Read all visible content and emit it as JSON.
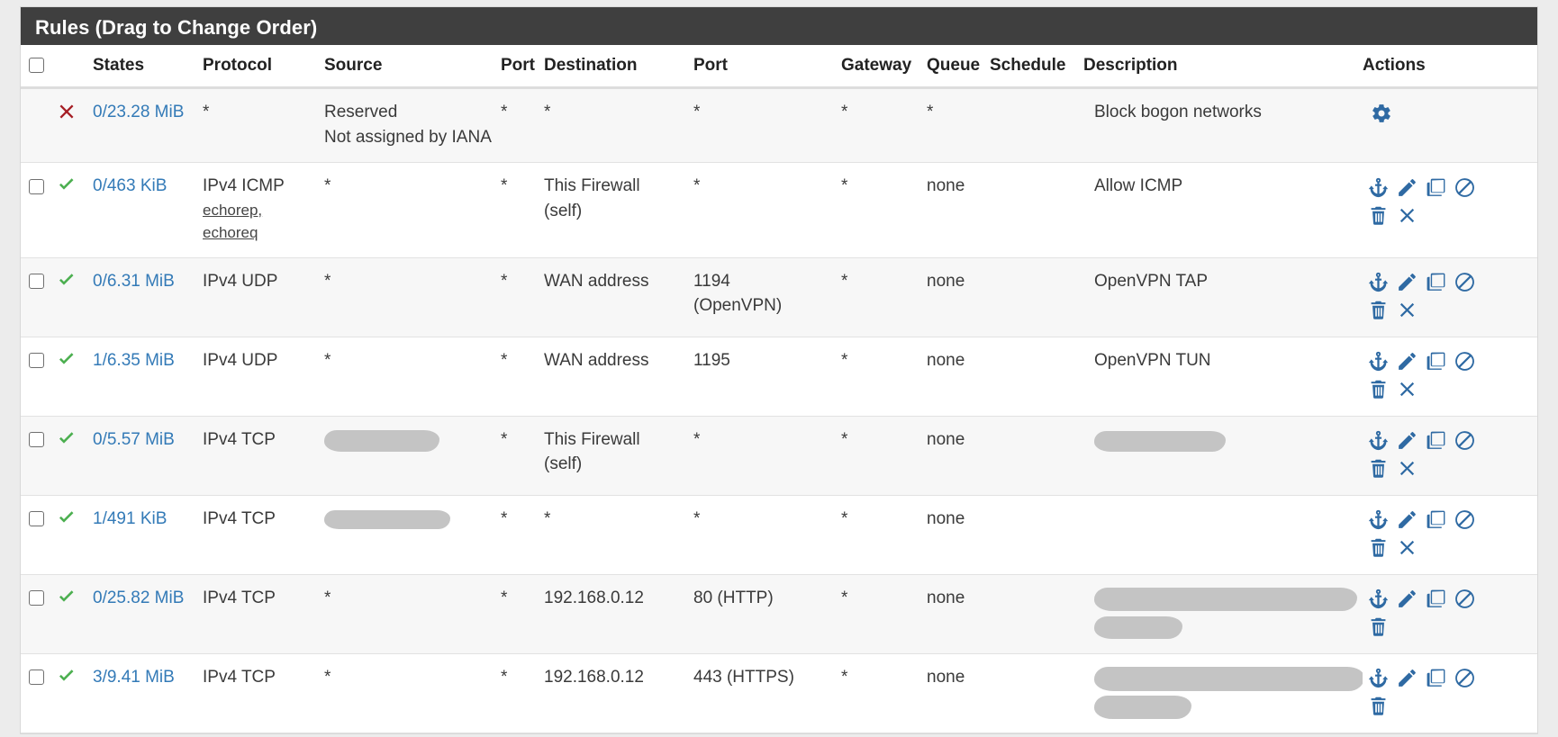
{
  "panel": {
    "title": "Rules (Drag to Change Order)"
  },
  "table": {
    "columns": [
      {
        "key": "check",
        "label": ""
      },
      {
        "key": "action",
        "label": ""
      },
      {
        "key": "states",
        "label": "States"
      },
      {
        "key": "protocol",
        "label": "Protocol"
      },
      {
        "key": "source",
        "label": "Source"
      },
      {
        "key": "sport",
        "label": "Port"
      },
      {
        "key": "dest",
        "label": "Destination"
      },
      {
        "key": "dport",
        "label": "Port"
      },
      {
        "key": "gateway",
        "label": "Gateway"
      },
      {
        "key": "queue",
        "label": "Queue"
      },
      {
        "key": "schedule",
        "label": "Schedule"
      },
      {
        "key": "desc",
        "label": "Description"
      },
      {
        "key": "actions",
        "label": "Actions"
      }
    ],
    "rows": [
      {
        "action_icon": "block-x-icon",
        "has_checkbox": false,
        "states": "0/23.28 MiB",
        "protocol": "*",
        "protocol_sub": [],
        "source": "Reserved\nNot assigned by IANA",
        "source_redacted": false,
        "sport": "*",
        "dest": "*",
        "dport": "*",
        "gateway": "*",
        "queue": "*",
        "schedule": "",
        "desc": "Block bogon networks",
        "desc_redacted": false,
        "actions": [
          "gear-icon"
        ]
      },
      {
        "action_icon": "pass-check-icon",
        "has_checkbox": true,
        "states": "0/463 KiB",
        "protocol": "IPv4 ICMP",
        "protocol_sub": [
          "echorep,",
          "echoreq"
        ],
        "source": "*",
        "source_redacted": false,
        "sport": "*",
        "dest": "This Firewall (self)",
        "dport": "*",
        "gateway": "*",
        "queue": "none",
        "schedule": "",
        "desc": "Allow ICMP",
        "desc_redacted": false,
        "actions": [
          "anchor-icon",
          "edit-pencil-icon",
          "copy-icon",
          "disable-ban-icon",
          "delete-trash-icon",
          "remove-x-icon"
        ]
      },
      {
        "action_icon": "pass-check-icon",
        "has_checkbox": true,
        "states": "0/6.31 MiB",
        "protocol": "IPv4 UDP",
        "protocol_sub": [],
        "source": "*",
        "source_redacted": false,
        "sport": "*",
        "dest": "WAN address",
        "dport": "1194 (OpenVPN)",
        "gateway": "*",
        "queue": "none",
        "schedule": "",
        "desc": "OpenVPN TAP",
        "desc_redacted": false,
        "actions": [
          "anchor-icon",
          "edit-pencil-icon",
          "copy-icon",
          "disable-ban-icon",
          "delete-trash-icon",
          "remove-x-icon"
        ]
      },
      {
        "action_icon": "pass-check-icon",
        "has_checkbox": true,
        "states": "1/6.35 MiB",
        "protocol": "IPv4 UDP",
        "protocol_sub": [],
        "source": "*",
        "source_redacted": false,
        "sport": "*",
        "dest": "WAN address",
        "dport": "1195",
        "gateway": "*",
        "queue": "none",
        "schedule": "",
        "desc": "OpenVPN TUN",
        "desc_redacted": false,
        "actions": [
          "anchor-icon",
          "edit-pencil-icon",
          "copy-icon",
          "disable-ban-icon",
          "delete-trash-icon",
          "remove-x-icon"
        ]
      },
      {
        "action_icon": "pass-check-icon",
        "has_checkbox": true,
        "states": "0/5.57 MiB",
        "protocol": "IPv4 TCP",
        "protocol_sub": [],
        "source": "",
        "source_redacted": true,
        "sport": "*",
        "dest": "This Firewall (self)",
        "dport": "*",
        "gateway": "*",
        "queue": "none",
        "schedule": "",
        "desc": "",
        "desc_redacted": true,
        "actions": [
          "anchor-icon",
          "edit-pencil-icon",
          "copy-icon",
          "disable-ban-icon",
          "delete-trash-icon",
          "remove-x-icon"
        ]
      },
      {
        "action_icon": "pass-check-icon",
        "has_checkbox": true,
        "states": "1/491 KiB",
        "protocol": "IPv4 TCP",
        "protocol_sub": [],
        "source": "",
        "source_redacted": true,
        "sport": "*",
        "dest": "*",
        "dport": "*",
        "gateway": "*",
        "queue": "none",
        "schedule": "",
        "desc": "",
        "desc_redacted": false,
        "actions": [
          "anchor-icon",
          "edit-pencil-icon",
          "copy-icon",
          "disable-ban-icon",
          "delete-trash-icon",
          "remove-x-icon"
        ]
      },
      {
        "action_icon": "pass-check-icon",
        "has_checkbox": true,
        "states": "0/25.82 MiB",
        "protocol": "IPv4 TCP",
        "protocol_sub": [],
        "source": "*",
        "source_redacted": false,
        "sport": "*",
        "dest": "192.168.0.12",
        "dport": "80 (HTTP)",
        "gateway": "*",
        "queue": "none",
        "schedule": "",
        "desc": "",
        "desc_redacted": true,
        "actions": [
          "anchor-icon",
          "edit-pencil-icon",
          "copy-icon",
          "disable-ban-icon",
          "delete-trash-icon"
        ]
      },
      {
        "action_icon": "pass-check-icon",
        "has_checkbox": true,
        "states": "3/9.41 MiB",
        "protocol": "IPv4 TCP",
        "protocol_sub": [],
        "source": "*",
        "source_redacted": false,
        "sport": "*",
        "dest": "192.168.0.12",
        "dport": "443 (HTTPS)",
        "gateway": "*",
        "queue": "none",
        "schedule": "",
        "desc": "",
        "desc_redacted": true,
        "actions": [
          "anchor-icon",
          "edit-pencil-icon",
          "copy-icon",
          "disable-ban-icon",
          "delete-trash-icon"
        ]
      }
    ]
  },
  "colors": {
    "header_bg": "#3f3f3f",
    "link": "#337ab7",
    "pass_green": "#4caf50",
    "block_red": "#a51d24",
    "action_blue": "#2f6aa3",
    "redaction_grey": "#c4c4c4"
  }
}
